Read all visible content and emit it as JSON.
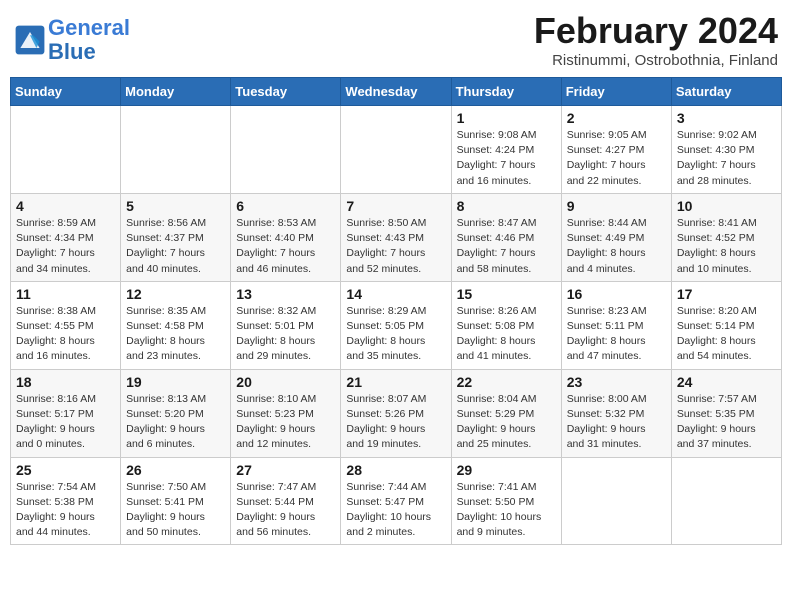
{
  "header": {
    "logo_line1": "General",
    "logo_line2": "Blue",
    "month_title": "February 2024",
    "subtitle": "Ristinummi, Ostrobothnia, Finland"
  },
  "days_of_week": [
    "Sunday",
    "Monday",
    "Tuesday",
    "Wednesday",
    "Thursday",
    "Friday",
    "Saturday"
  ],
  "weeks": [
    [
      {
        "num": "",
        "info": ""
      },
      {
        "num": "",
        "info": ""
      },
      {
        "num": "",
        "info": ""
      },
      {
        "num": "",
        "info": ""
      },
      {
        "num": "1",
        "info": "Sunrise: 9:08 AM\nSunset: 4:24 PM\nDaylight: 7 hours\nand 16 minutes."
      },
      {
        "num": "2",
        "info": "Sunrise: 9:05 AM\nSunset: 4:27 PM\nDaylight: 7 hours\nand 22 minutes."
      },
      {
        "num": "3",
        "info": "Sunrise: 9:02 AM\nSunset: 4:30 PM\nDaylight: 7 hours\nand 28 minutes."
      }
    ],
    [
      {
        "num": "4",
        "info": "Sunrise: 8:59 AM\nSunset: 4:34 PM\nDaylight: 7 hours\nand 34 minutes."
      },
      {
        "num": "5",
        "info": "Sunrise: 8:56 AM\nSunset: 4:37 PM\nDaylight: 7 hours\nand 40 minutes."
      },
      {
        "num": "6",
        "info": "Sunrise: 8:53 AM\nSunset: 4:40 PM\nDaylight: 7 hours\nand 46 minutes."
      },
      {
        "num": "7",
        "info": "Sunrise: 8:50 AM\nSunset: 4:43 PM\nDaylight: 7 hours\nand 52 minutes."
      },
      {
        "num": "8",
        "info": "Sunrise: 8:47 AM\nSunset: 4:46 PM\nDaylight: 7 hours\nand 58 minutes."
      },
      {
        "num": "9",
        "info": "Sunrise: 8:44 AM\nSunset: 4:49 PM\nDaylight: 8 hours\nand 4 minutes."
      },
      {
        "num": "10",
        "info": "Sunrise: 8:41 AM\nSunset: 4:52 PM\nDaylight: 8 hours\nand 10 minutes."
      }
    ],
    [
      {
        "num": "11",
        "info": "Sunrise: 8:38 AM\nSunset: 4:55 PM\nDaylight: 8 hours\nand 16 minutes."
      },
      {
        "num": "12",
        "info": "Sunrise: 8:35 AM\nSunset: 4:58 PM\nDaylight: 8 hours\nand 23 minutes."
      },
      {
        "num": "13",
        "info": "Sunrise: 8:32 AM\nSunset: 5:01 PM\nDaylight: 8 hours\nand 29 minutes."
      },
      {
        "num": "14",
        "info": "Sunrise: 8:29 AM\nSunset: 5:05 PM\nDaylight: 8 hours\nand 35 minutes."
      },
      {
        "num": "15",
        "info": "Sunrise: 8:26 AM\nSunset: 5:08 PM\nDaylight: 8 hours\nand 41 minutes."
      },
      {
        "num": "16",
        "info": "Sunrise: 8:23 AM\nSunset: 5:11 PM\nDaylight: 8 hours\nand 47 minutes."
      },
      {
        "num": "17",
        "info": "Sunrise: 8:20 AM\nSunset: 5:14 PM\nDaylight: 8 hours\nand 54 minutes."
      }
    ],
    [
      {
        "num": "18",
        "info": "Sunrise: 8:16 AM\nSunset: 5:17 PM\nDaylight: 9 hours\nand 0 minutes."
      },
      {
        "num": "19",
        "info": "Sunrise: 8:13 AM\nSunset: 5:20 PM\nDaylight: 9 hours\nand 6 minutes."
      },
      {
        "num": "20",
        "info": "Sunrise: 8:10 AM\nSunset: 5:23 PM\nDaylight: 9 hours\nand 12 minutes."
      },
      {
        "num": "21",
        "info": "Sunrise: 8:07 AM\nSunset: 5:26 PM\nDaylight: 9 hours\nand 19 minutes."
      },
      {
        "num": "22",
        "info": "Sunrise: 8:04 AM\nSunset: 5:29 PM\nDaylight: 9 hours\nand 25 minutes."
      },
      {
        "num": "23",
        "info": "Sunrise: 8:00 AM\nSunset: 5:32 PM\nDaylight: 9 hours\nand 31 minutes."
      },
      {
        "num": "24",
        "info": "Sunrise: 7:57 AM\nSunset: 5:35 PM\nDaylight: 9 hours\nand 37 minutes."
      }
    ],
    [
      {
        "num": "25",
        "info": "Sunrise: 7:54 AM\nSunset: 5:38 PM\nDaylight: 9 hours\nand 44 minutes."
      },
      {
        "num": "26",
        "info": "Sunrise: 7:50 AM\nSunset: 5:41 PM\nDaylight: 9 hours\nand 50 minutes."
      },
      {
        "num": "27",
        "info": "Sunrise: 7:47 AM\nSunset: 5:44 PM\nDaylight: 9 hours\nand 56 minutes."
      },
      {
        "num": "28",
        "info": "Sunrise: 7:44 AM\nSunset: 5:47 PM\nDaylight: 10 hours\nand 2 minutes."
      },
      {
        "num": "29",
        "info": "Sunrise: 7:41 AM\nSunset: 5:50 PM\nDaylight: 10 hours\nand 9 minutes."
      },
      {
        "num": "",
        "info": ""
      },
      {
        "num": "",
        "info": ""
      }
    ]
  ]
}
